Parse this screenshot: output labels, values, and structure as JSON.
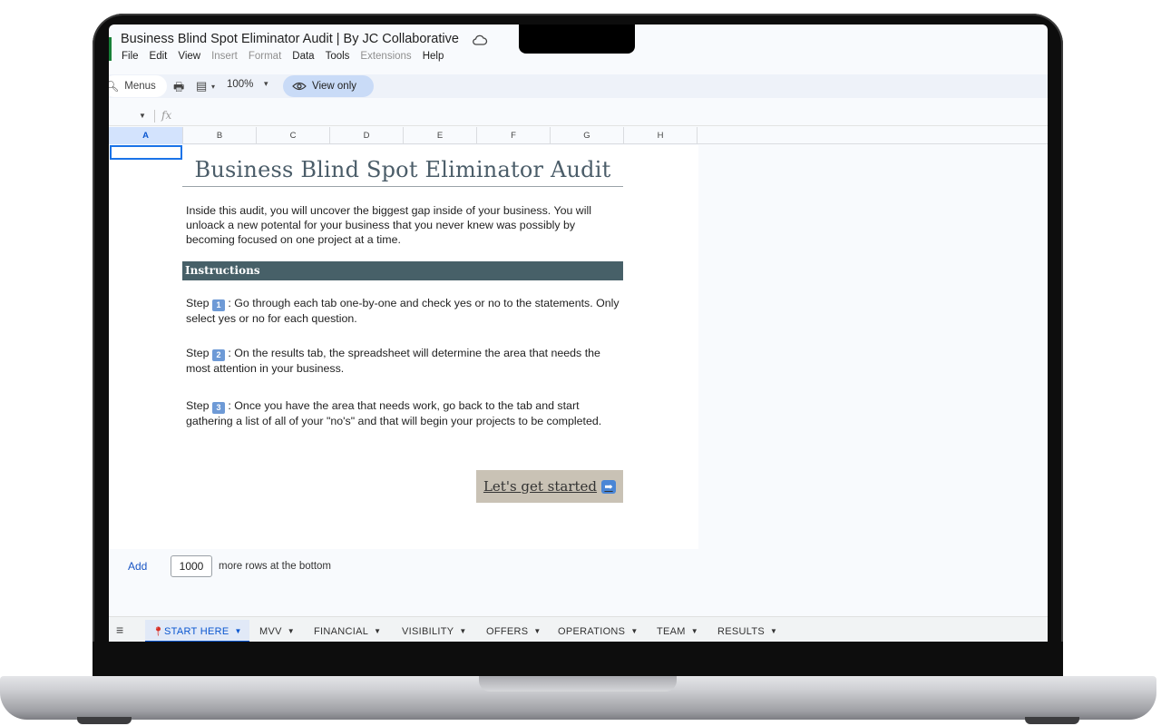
{
  "window": {
    "title": "Business Blind Spot Eliminator Audit | By JC Collaborative"
  },
  "menu": {
    "items": [
      {
        "label": "File",
        "enabled": true
      },
      {
        "label": "Edit",
        "enabled": true
      },
      {
        "label": "View",
        "enabled": true
      },
      {
        "label": "Insert",
        "enabled": false
      },
      {
        "label": "Format",
        "enabled": false
      },
      {
        "label": "Data",
        "enabled": true
      },
      {
        "label": "Tools",
        "enabled": true
      },
      {
        "label": "Extensions",
        "enabled": false
      },
      {
        "label": "Help",
        "enabled": true
      }
    ]
  },
  "toolbar": {
    "menus_label": "Menus",
    "zoom": "100%",
    "view_only_label": "View only"
  },
  "formula_bar": {
    "fx": "fx"
  },
  "grid": {
    "columns": [
      "A",
      "B",
      "C",
      "D",
      "E",
      "F",
      "G",
      "H"
    ],
    "active_column": "A"
  },
  "sheet": {
    "title": "Business Blind Spot Eliminator Audit",
    "intro": "Inside this audit, you will uncover the biggest gap inside of your business. You will unloack a new potental for your business that you never knew was possibly by becoming focused on one project at a time.",
    "instructions_heading": "Instructions",
    "steps": [
      {
        "prefix": "Step",
        "number": "1",
        "text": ": Go through each tab one-by-one and check yes or no to the statements. Only select yes or no for each question."
      },
      {
        "prefix": "Step",
        "number": "2",
        "text": ": On the results tab, the spreadsheet will determine the area that needs the most attention in your business."
      },
      {
        "prefix": "Step",
        "number": "3",
        "text": ": Once you have the area that needs work, go back to the tab and start gathering a list of all of your \"no's\" and that will begin your projects to be completed."
      }
    ],
    "cta_label": "Let's get started"
  },
  "add_rows": {
    "add_label": "Add",
    "count": "1000",
    "suffix": "more rows at the bottom"
  },
  "tabs": [
    {
      "label": "START HERE",
      "active": true,
      "pinned": true
    },
    {
      "label": "MVV",
      "active": false
    },
    {
      "label": "FINANCIAL",
      "active": false
    },
    {
      "label": "VISIBILITY",
      "active": false
    },
    {
      "label": "OFFERS",
      "active": false
    },
    {
      "label": "OPERATIONS",
      "active": false
    },
    {
      "label": "TEAM",
      "active": false
    },
    {
      "label": "RESULTS",
      "active": false
    }
  ],
  "colors": {
    "instructions_bg": "#476068",
    "title_text": "#4b5d69",
    "cta_bg": "#c9c2b5",
    "view_only_bg": "#c9dbf7",
    "active_tab": "#0b57d0"
  }
}
